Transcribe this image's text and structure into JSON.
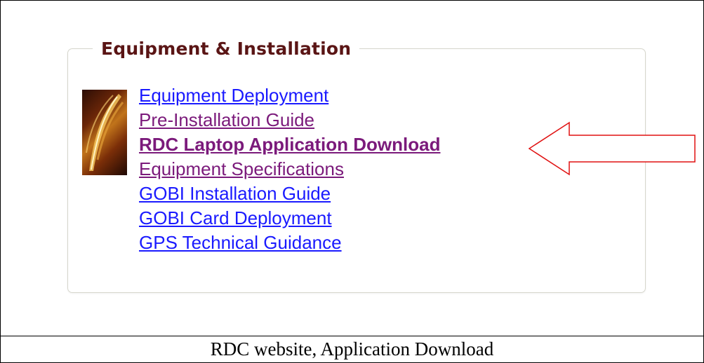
{
  "section": {
    "legend": "Equipment & Installation"
  },
  "links": [
    {
      "label": "Equipment Deployment",
      "state": "unvisited"
    },
    {
      "label": "Pre-Installation Guide",
      "state": "visited"
    },
    {
      "label": "RDC Laptop Application Download",
      "state": "highlighted"
    },
    {
      "label": "Equipment Specifications",
      "state": "visited"
    },
    {
      "label": "GOBI Installation Guide",
      "state": "unvisited"
    },
    {
      "label": "GOBI Card Deployment",
      "state": "unvisited"
    },
    {
      "label": "GPS Technical Guidance",
      "state": "unvisited"
    }
  ],
  "caption": "RDC website, Application Download",
  "colors": {
    "legend": "#5a1515",
    "link_unvisited": "#1a1aff",
    "link_visited": "#7b1a7b",
    "arrow_stroke": "#e01010",
    "fieldset_border": "#d6d6cc"
  },
  "icons": {
    "thumbnail": "feather-quill-icon",
    "callout": "left-arrow-icon"
  }
}
